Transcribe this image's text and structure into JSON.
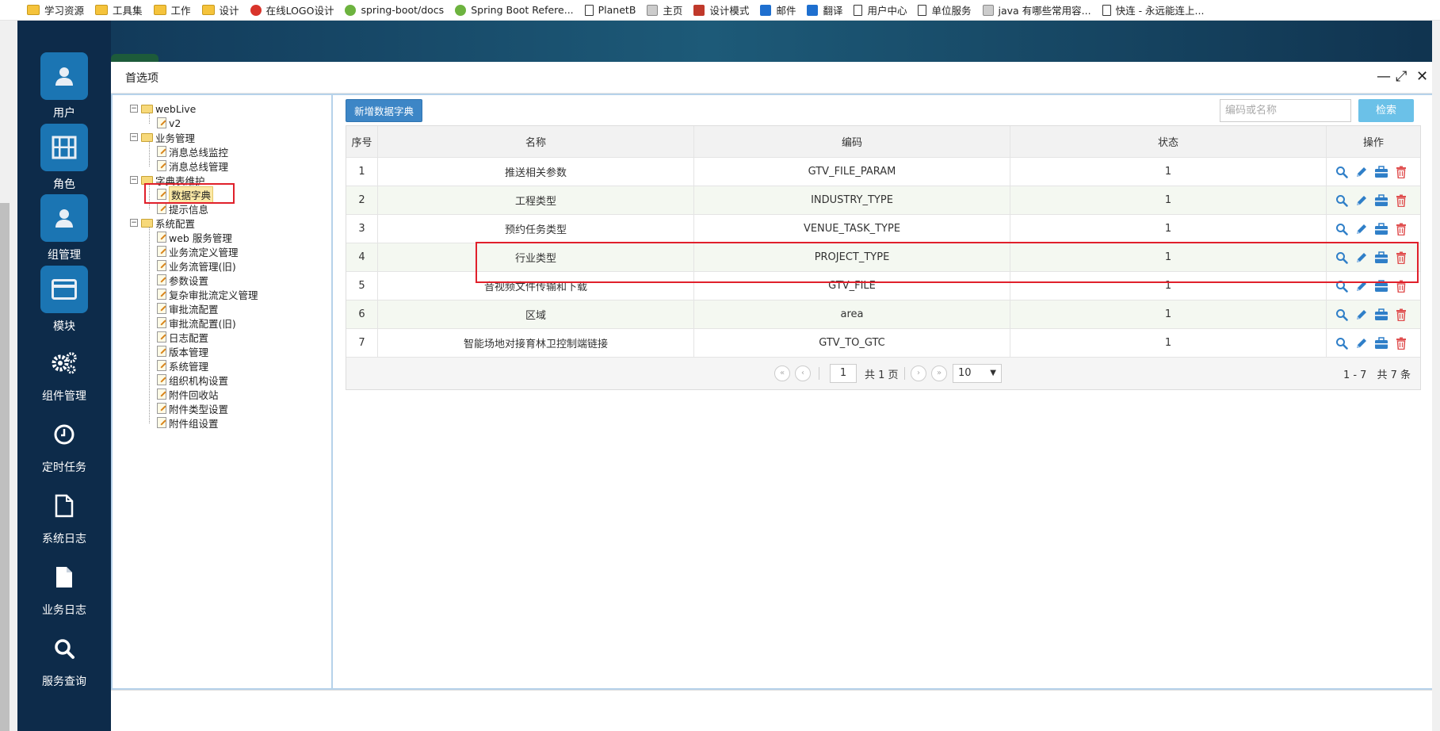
{
  "bookmarks": [
    {
      "label": "学习资源",
      "icon": "folder"
    },
    {
      "label": "工具集",
      "icon": "folder"
    },
    {
      "label": "工作",
      "icon": "folder"
    },
    {
      "label": "设计",
      "icon": "folder"
    },
    {
      "label": "在线LOGO设计",
      "icon": "red"
    },
    {
      "label": "spring-boot/docs",
      "icon": "leaf"
    },
    {
      "label": "Spring Boot Refere...",
      "icon": "leaf"
    },
    {
      "label": "PlanetB",
      "icon": "page"
    },
    {
      "label": "主页",
      "icon": "ppl"
    },
    {
      "label": "设计模式",
      "icon": "box"
    },
    {
      "label": "邮件",
      "icon": "blue"
    },
    {
      "label": "翻译",
      "icon": "blue"
    },
    {
      "label": "用户中心",
      "icon": "page"
    },
    {
      "label": "单位服务",
      "icon": "page"
    },
    {
      "label": "java 有哪些常用容...",
      "icon": "ppl"
    },
    {
      "label": "快连 - 永远能连上...",
      "icon": "page"
    }
  ],
  "nav": [
    {
      "label": "用户",
      "icon": "user-icon"
    },
    {
      "label": "角色",
      "icon": "film-icon"
    },
    {
      "label": "组管理",
      "icon": "group-icon"
    },
    {
      "label": "模块",
      "icon": "card-icon"
    },
    {
      "label": "组件管理",
      "icon": "gears-icon"
    },
    {
      "label": "定时任务",
      "icon": "clock-icon"
    },
    {
      "label": "系统日志",
      "icon": "file-icon"
    },
    {
      "label": "业务日志",
      "icon": "file-filled-icon"
    },
    {
      "label": "服务查询",
      "icon": "search-icon"
    }
  ],
  "dialog": {
    "title": "首选项",
    "controls": {
      "minimize": "—",
      "maximize": "⤢",
      "close": "✕"
    }
  },
  "tree": {
    "nodes": [
      {
        "label": "webLive",
        "type": "folder"
      },
      {
        "label": "v2",
        "type": "leaf"
      },
      {
        "label": "业务管理",
        "type": "folder"
      },
      {
        "label": "消息总线监控",
        "type": "leaf"
      },
      {
        "label": "消息总线管理",
        "type": "leaf"
      },
      {
        "label": "字典表维护",
        "type": "folder"
      },
      {
        "label": "数据字典",
        "type": "leaf"
      },
      {
        "label": "提示信息",
        "type": "leaf"
      },
      {
        "label": "系统配置",
        "type": "folder"
      },
      {
        "label": "web 服务管理",
        "type": "leaf"
      },
      {
        "label": "业务流定义管理",
        "type": "leaf"
      },
      {
        "label": "业务流管理(旧)",
        "type": "leaf"
      },
      {
        "label": "参数设置",
        "type": "leaf"
      },
      {
        "label": "复杂审批流定义管理",
        "type": "leaf"
      },
      {
        "label": "审批流配置",
        "type": "leaf"
      },
      {
        "label": "审批流配置(旧)",
        "type": "leaf"
      },
      {
        "label": "日志配置",
        "type": "leaf"
      },
      {
        "label": "版本管理",
        "type": "leaf"
      },
      {
        "label": "系统管理",
        "type": "leaf"
      },
      {
        "label": "组织机构设置",
        "type": "leaf"
      },
      {
        "label": "附件回收站",
        "type": "leaf"
      },
      {
        "label": "附件类型设置",
        "type": "leaf"
      },
      {
        "label": "附件组设置",
        "type": "leaf"
      }
    ],
    "toggle_symbol": "⊟"
  },
  "toolbar": {
    "add_label": "新增数据字典",
    "search_placeholder": "编码或名称",
    "search_label": "检索"
  },
  "table": {
    "headers": [
      "序号",
      "名称",
      "编码",
      "状态",
      "操作"
    ],
    "rows": [
      [
        "1",
        "推送相关参数",
        "GTV_FILE_PARAM",
        "1"
      ],
      [
        "2",
        "工程类型",
        "INDUSTRY_TYPE",
        "1"
      ],
      [
        "3",
        "预约任务类型",
        "VENUE_TASK_TYPE",
        "1"
      ],
      [
        "4",
        "行业类型",
        "PROJECT_TYPE",
        "1"
      ],
      [
        "5",
        "音视频文件传输和下载",
        "GTV_FILE",
        "1"
      ],
      [
        "6",
        "区域",
        "area",
        "1"
      ],
      [
        "7",
        "智能场地对接育林卫控制端链接",
        "GTV_TO_GTC",
        "1"
      ]
    ],
    "actions": [
      "view-icon",
      "edit-icon",
      "toolbox-icon",
      "delete-icon"
    ]
  },
  "pager": {
    "first": "«",
    "prev": "‹",
    "next": "›",
    "last": "»",
    "current_page": "1",
    "total_pages_text": "共 1 页",
    "page_size": "10",
    "info": "1 - 7　共 7 条"
  },
  "colors": {
    "sidebar": "#0d2b4a",
    "tile": "#1b75b3",
    "highlight_red": "#e0202b",
    "action_blue": "#2f7fc8",
    "action_red": "#e05050"
  }
}
